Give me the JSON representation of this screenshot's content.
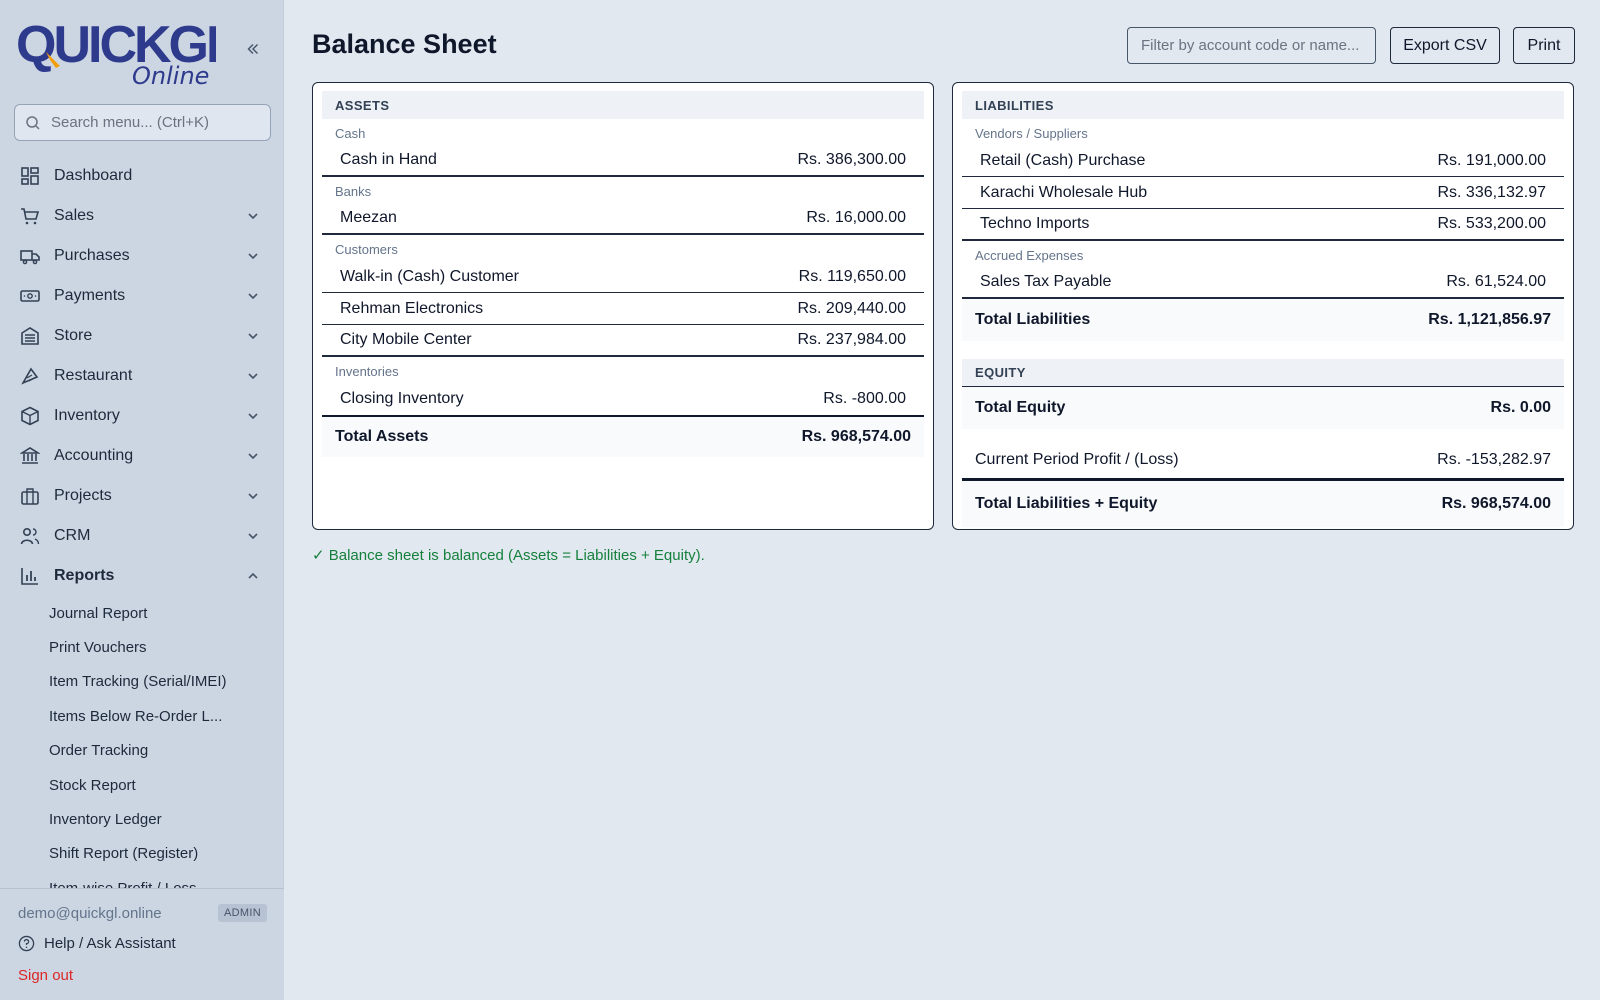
{
  "brand": {
    "logo_text": "QUICKGL",
    "logo_sub": "Online",
    "colors": {
      "primary": "#2e3a8c",
      "accent": "#f59e0b"
    }
  },
  "sidebar": {
    "collapse_icon": "double-chevron-left-icon",
    "search_placeholder": "Search menu... (Ctrl+K)",
    "items": [
      {
        "label": "Dashboard",
        "icon": "dashboard-icon",
        "expandable": false
      },
      {
        "label": "Sales",
        "icon": "cart-icon",
        "expandable": true
      },
      {
        "label": "Purchases",
        "icon": "truck-icon",
        "expandable": true
      },
      {
        "label": "Payments",
        "icon": "money-icon",
        "expandable": true
      },
      {
        "label": "Store",
        "icon": "store-icon",
        "expandable": true
      },
      {
        "label": "Restaurant",
        "icon": "restaurant-icon",
        "expandable": true
      },
      {
        "label": "Inventory",
        "icon": "box-icon",
        "expandable": true
      },
      {
        "label": "Accounting",
        "icon": "bank-icon",
        "expandable": true
      },
      {
        "label": "Projects",
        "icon": "briefcase-icon",
        "expandable": true
      },
      {
        "label": "CRM",
        "icon": "users-icon",
        "expandable": true
      },
      {
        "label": "Reports",
        "icon": "bar-chart-icon",
        "expandable": true,
        "expanded": true
      }
    ],
    "reports_sub": [
      "Journal Report",
      "Print Vouchers",
      "Item Tracking (Serial/IMEI)",
      "Items Below Re-Order L...",
      "Order Tracking",
      "Stock Report",
      "Inventory Ledger",
      "Shift Report (Register)",
      "Item-wise Profit / Loss"
    ],
    "footer": {
      "user": "demo@quickgl.online",
      "role": "ADMIN",
      "help": "Help / Ask Assistant",
      "signout": "Sign out"
    }
  },
  "page": {
    "title": "Balance Sheet",
    "filter_placeholder": "Filter by account code or name...",
    "export_label": "Export CSV",
    "print_label": "Print",
    "balanced_message": "✓ Balance sheet is balanced (Assets = Liabilities + Equity)."
  },
  "assets": {
    "heading": "ASSETS",
    "groups": [
      {
        "name": "Cash",
        "rows": [
          {
            "label": "Cash in Hand",
            "amount": "Rs. 386,300.00"
          }
        ]
      },
      {
        "name": "Banks",
        "rows": [
          {
            "label": "Meezan",
            "amount": "Rs. 16,000.00"
          }
        ]
      },
      {
        "name": "Customers",
        "rows": [
          {
            "label": "Walk-in (Cash) Customer",
            "amount": "Rs. 119,650.00"
          },
          {
            "label": "Rehman Electronics",
            "amount": "Rs. 209,440.00"
          },
          {
            "label": "City Mobile Center",
            "amount": "Rs. 237,984.00"
          }
        ]
      },
      {
        "name": "Inventories",
        "rows": [
          {
            "label": "Closing Inventory",
            "amount": "Rs. -800.00"
          }
        ]
      }
    ],
    "total_label": "Total Assets",
    "total_amount": "Rs. 968,574.00"
  },
  "liabilities": {
    "heading": "LIABILITIES",
    "groups": [
      {
        "name": "Vendors / Suppliers",
        "rows": [
          {
            "label": "Retail (Cash) Purchase",
            "amount": "Rs. 191,000.00"
          },
          {
            "label": "Karachi Wholesale Hub",
            "amount": "Rs. 336,132.97"
          },
          {
            "label": "Techno Imports",
            "amount": "Rs. 533,200.00"
          }
        ]
      },
      {
        "name": "Accrued Expenses",
        "rows": [
          {
            "label": "Sales Tax Payable",
            "amount": "Rs. 61,524.00"
          }
        ]
      }
    ],
    "total_label": "Total Liabilities",
    "total_amount": "Rs. 1,121,856.97"
  },
  "equity": {
    "heading": "EQUITY",
    "total_label": "Total Equity",
    "total_amount": "Rs. 0.00",
    "profit_label": "Current Period Profit / (Loss)",
    "profit_amount": "Rs. -153,282.97",
    "grand_label": "Total Liabilities + Equity",
    "grand_amount": "Rs. 968,574.00"
  }
}
